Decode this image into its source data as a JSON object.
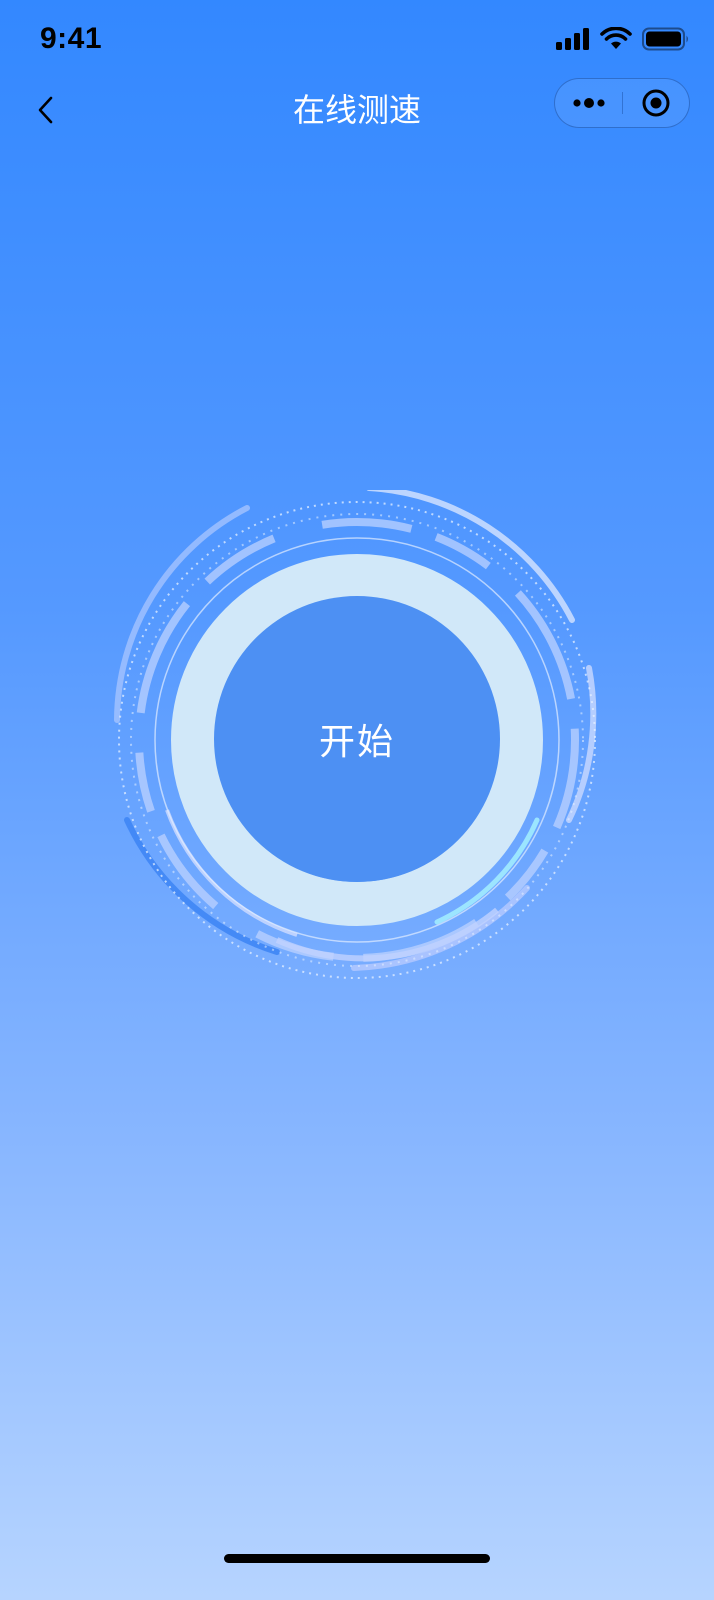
{
  "status_bar": {
    "time": "9:41",
    "icons": [
      "signal-icon",
      "wifi-icon",
      "battery-icon"
    ]
  },
  "nav": {
    "title": "在线测速",
    "back_icon": "chevron-left-icon",
    "more_icon": "more-dots-icon",
    "close_icon": "target-close-icon"
  },
  "dial": {
    "button_label": "开始"
  },
  "colors": {
    "background_top": "#3388ff",
    "background_bottom": "#b6d4ff",
    "ring_light": "#d1e8f9",
    "button_fill": "#4d90f3"
  }
}
